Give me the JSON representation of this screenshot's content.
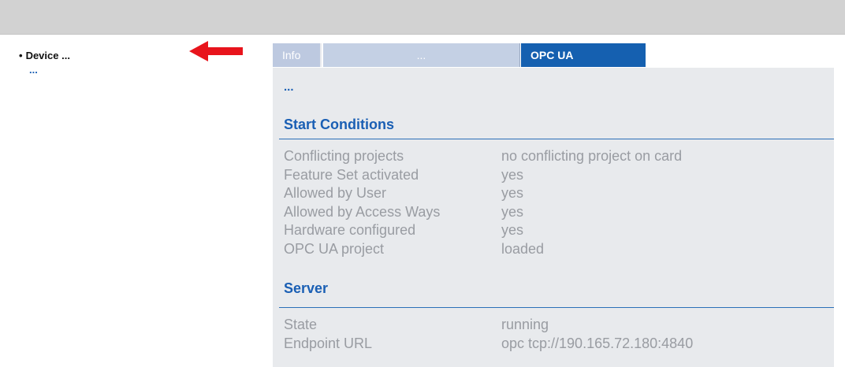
{
  "tree": {
    "bullet": "•",
    "item_label": "Device ...",
    "sub_label": "..."
  },
  "tabs": [
    {
      "label": "Info"
    },
    {
      "label": "..."
    },
    {
      "label": "OPC UA"
    }
  ],
  "content": {
    "ellipsis": "...",
    "start_conditions": {
      "title": "Start Conditions",
      "rows": [
        {
          "key": "Conflicting projects",
          "value": "no conflicting project on card"
        },
        {
          "key": "Feature Set activated",
          "value": "yes"
        },
        {
          "key": "Allowed by User",
          "value": "yes"
        },
        {
          "key": "Allowed by Access Ways",
          "value": "yes"
        },
        {
          "key": "Hardware configured",
          "value": "yes"
        },
        {
          "key": "OPC UA project",
          "value": "loaded"
        }
      ]
    },
    "server": {
      "title": "Server",
      "rows": [
        {
          "key": "State",
          "value": "running"
        },
        {
          "key": "Endpoint URL",
          "value": "opc tcp://190.165.72.180:4840"
        }
      ]
    }
  },
  "colors": {
    "accent": "#1560b0",
    "arrow": "#e8141c",
    "topbar": "#d2d2d2",
    "panel_bg": "#e8eaed"
  },
  "icons": {
    "arrow": "left-arrow-icon"
  }
}
